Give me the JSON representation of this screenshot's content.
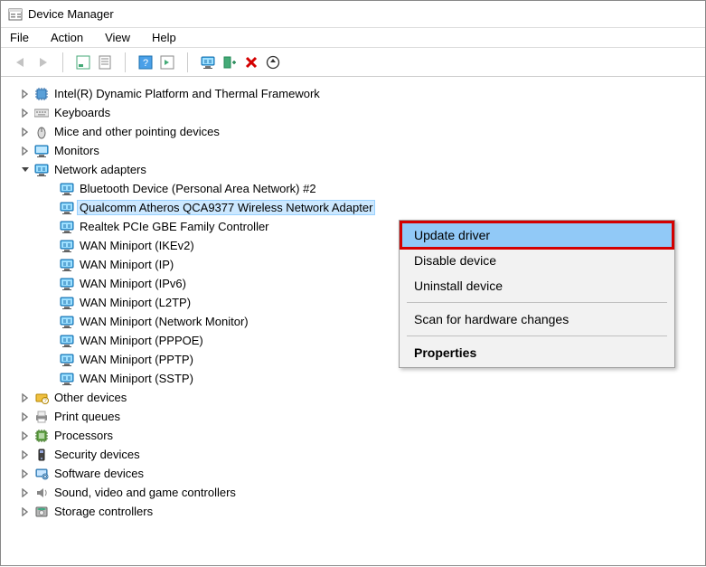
{
  "window": {
    "title": "Device Manager"
  },
  "menu": {
    "file": "File",
    "action": "Action",
    "view": "View",
    "help": "Help"
  },
  "tree": {
    "items": [
      {
        "id": "dptf",
        "expander": "right",
        "icon": "chip",
        "label": "Intel(R) Dynamic Platform and Thermal Framework"
      },
      {
        "id": "keyboards",
        "expander": "right",
        "icon": "keyboard",
        "label": "Keyboards"
      },
      {
        "id": "mice",
        "expander": "right",
        "icon": "mouse",
        "label": "Mice and other pointing devices"
      },
      {
        "id": "monitors",
        "expander": "right",
        "icon": "monitor",
        "label": "Monitors"
      },
      {
        "id": "netadapters",
        "expander": "down",
        "icon": "nic",
        "label": "Network adapters",
        "children": [
          {
            "id": "bt-pan",
            "icon": "nic",
            "label": "Bluetooth Device (Personal Area Network) #2"
          },
          {
            "id": "qca9377",
            "icon": "nic",
            "label": "Qualcomm Atheros QCA9377 Wireless Network Adapter",
            "selected": true
          },
          {
            "id": "realtek",
            "icon": "nic",
            "label": "Realtek PCIe GBE Family Controller"
          },
          {
            "id": "wan-ikev2",
            "icon": "nic",
            "label": "WAN Miniport (IKEv2)"
          },
          {
            "id": "wan-ip",
            "icon": "nic",
            "label": "WAN Miniport (IP)"
          },
          {
            "id": "wan-ipv6",
            "icon": "nic",
            "label": "WAN Miniport (IPv6)"
          },
          {
            "id": "wan-l2tp",
            "icon": "nic",
            "label": "WAN Miniport (L2TP)"
          },
          {
            "id": "wan-nm",
            "icon": "nic",
            "label": "WAN Miniport (Network Monitor)"
          },
          {
            "id": "wan-pppoe",
            "icon": "nic",
            "label": "WAN Miniport (PPPOE)"
          },
          {
            "id": "wan-pptp",
            "icon": "nic",
            "label": "WAN Miniport (PPTP)"
          },
          {
            "id": "wan-sstp",
            "icon": "nic",
            "label": "WAN Miniport (SSTP)"
          }
        ]
      },
      {
        "id": "other",
        "expander": "right",
        "icon": "other",
        "label": "Other devices"
      },
      {
        "id": "printq",
        "expander": "right",
        "icon": "printer",
        "label": "Print queues"
      },
      {
        "id": "cpus",
        "expander": "right",
        "icon": "cpu",
        "label": "Processors"
      },
      {
        "id": "security",
        "expander": "right",
        "icon": "security",
        "label": "Security devices"
      },
      {
        "id": "software",
        "expander": "right",
        "icon": "software",
        "label": "Software devices"
      },
      {
        "id": "sound",
        "expander": "right",
        "icon": "sound",
        "label": "Sound, video and game controllers"
      },
      {
        "id": "storage",
        "expander": "right",
        "icon": "storage",
        "label": "Storage controllers"
      }
    ]
  },
  "context_menu": {
    "update": "Update driver",
    "disable": "Disable device",
    "uninstall": "Uninstall device",
    "scan": "Scan for hardware changes",
    "props": "Properties"
  }
}
